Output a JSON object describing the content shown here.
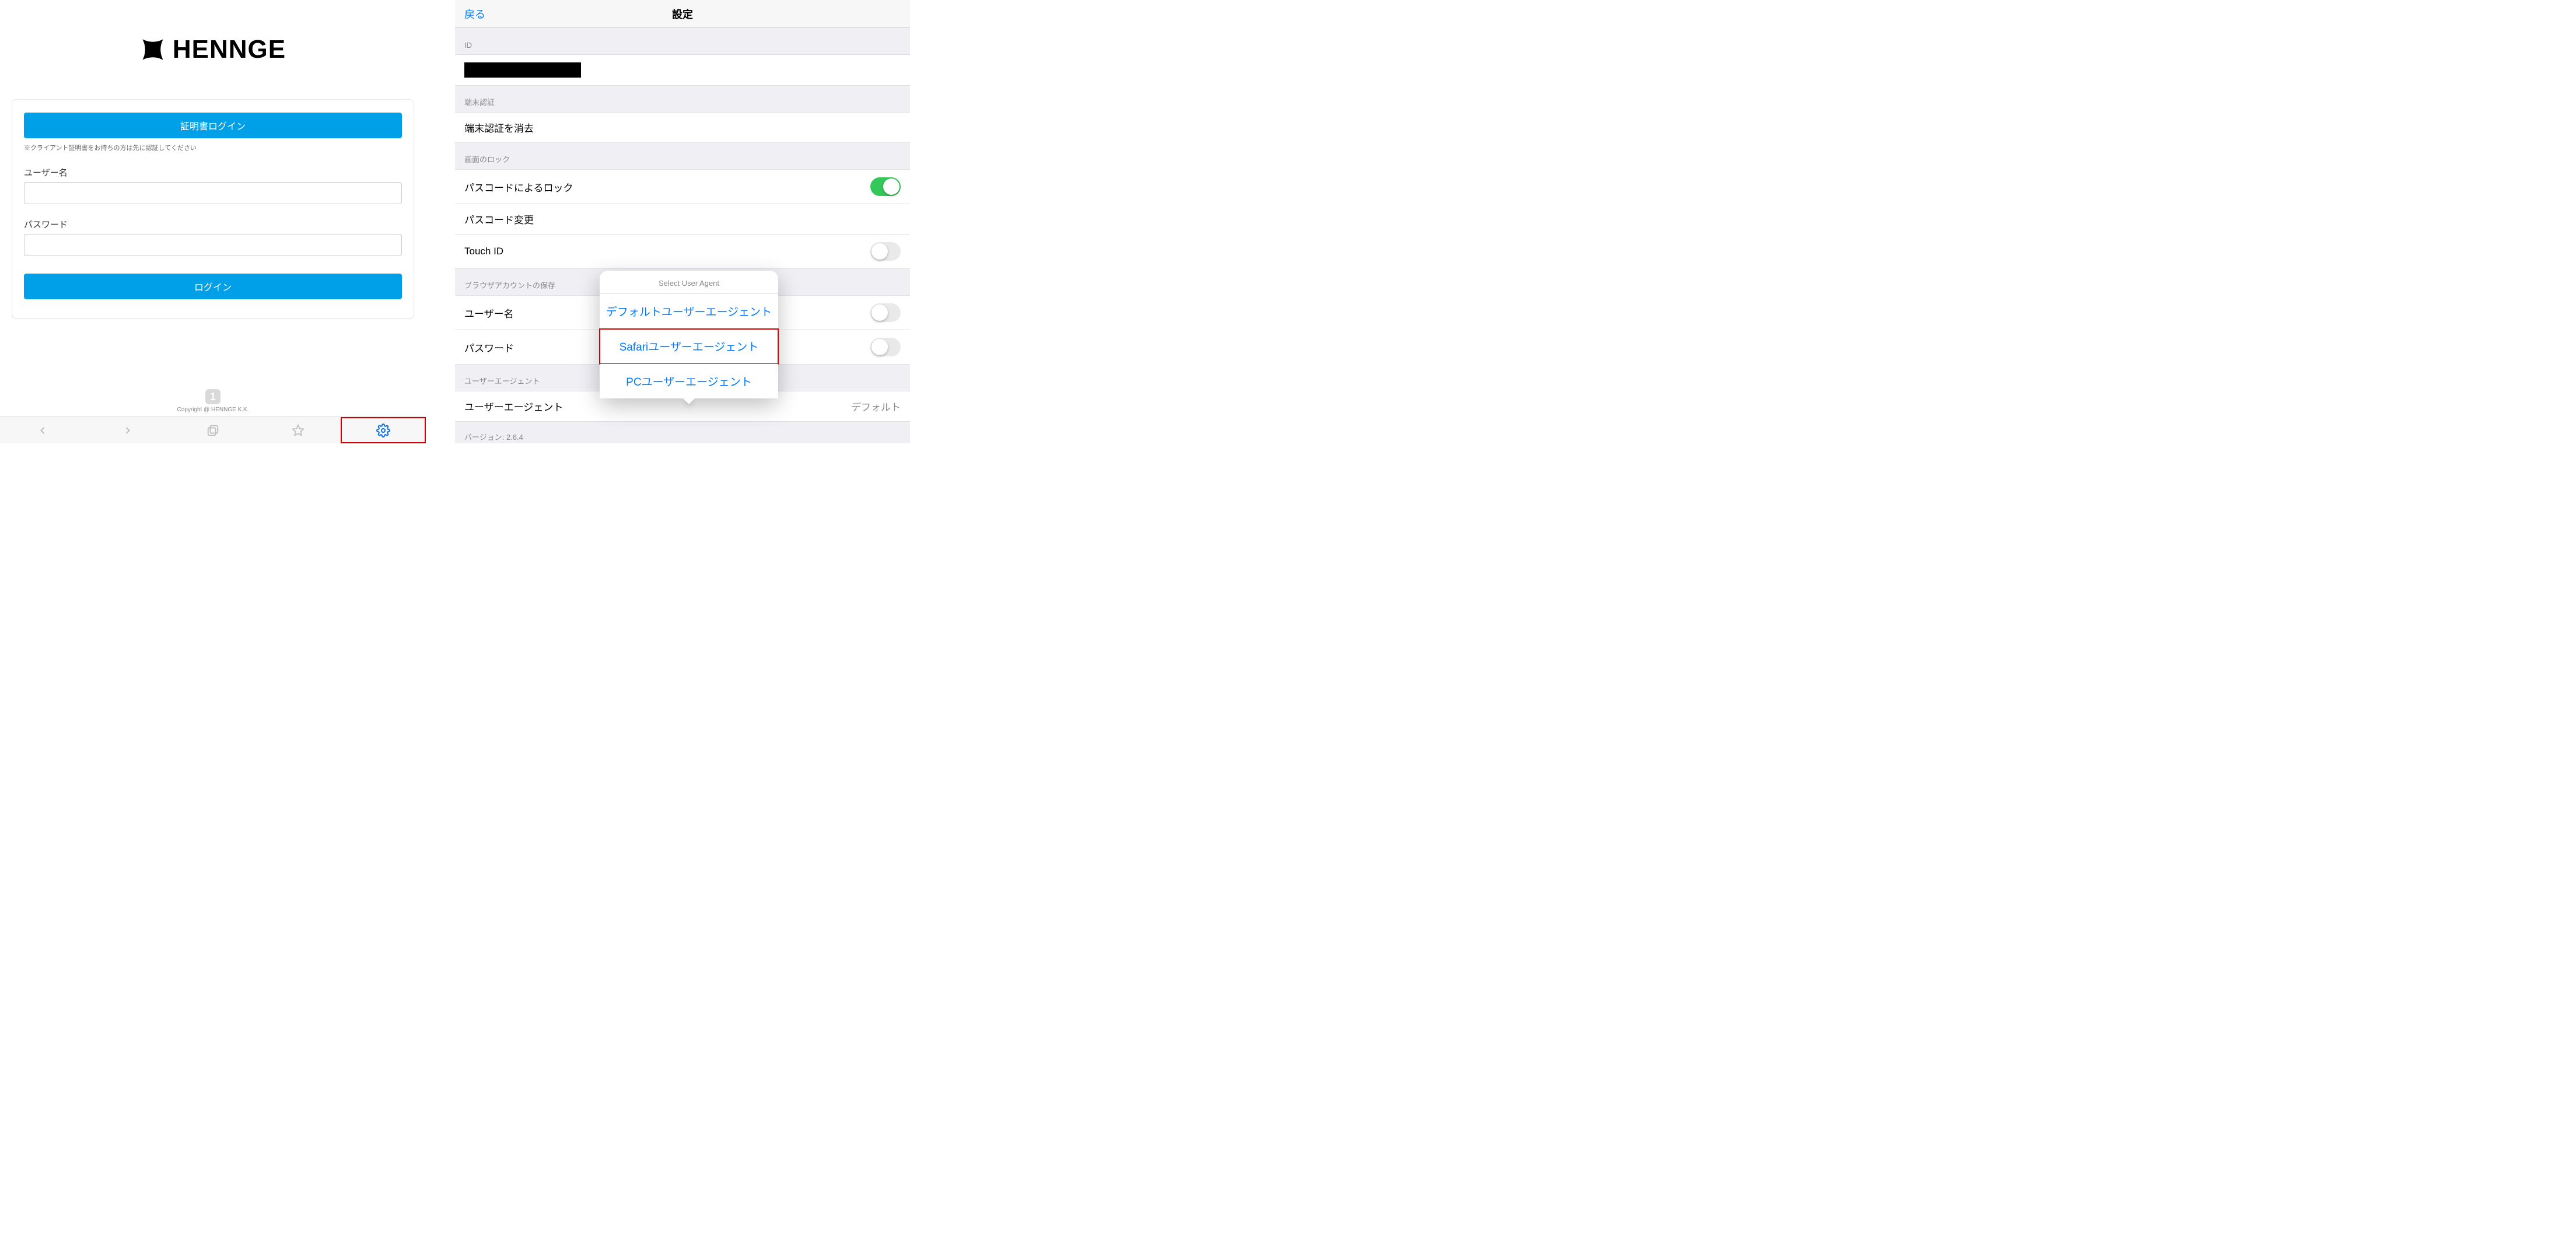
{
  "left": {
    "brand": "HENNGE",
    "cert_login_button": "証明書ログイン",
    "cert_note": "※クライアント証明書をお持ちの方は先に認証してください",
    "username_label": "ユーザー名",
    "password_label": "パスワード",
    "login_button": "ログイン",
    "badge_number": "1",
    "copyright": "Copyright @ HENNGE K.K."
  },
  "right": {
    "nav_back": "戻る",
    "nav_title": "設定",
    "sections": {
      "id_header": "ID",
      "device_auth_header": "端末認証",
      "clear_device_auth": "端末認証を消去",
      "screen_lock_header": "画面のロック",
      "passcode_lock": "パスコードによるロック",
      "passcode_change": "パスコード変更",
      "touch_id": "Touch ID",
      "browser_save_header": "ブラウザアカウントの保存",
      "username": "ユーザー名",
      "password": "パスワード",
      "user_agent_header": "ユーザーエージェント",
      "user_agent_label": "ユーザーエージェント",
      "user_agent_value": "デフォルト"
    },
    "version_label": "バージョン: ",
    "version_value": "2.6.4",
    "toggle_states": {
      "passcode_lock": true,
      "touch_id": false,
      "username": false,
      "password": false
    },
    "popover": {
      "title": "Select User Agent",
      "options": [
        "デフォルトユーザーエージェント",
        "Safariユーザーエージェント",
        "PCユーザーエージェント"
      ],
      "highlighted_index": 1
    }
  }
}
